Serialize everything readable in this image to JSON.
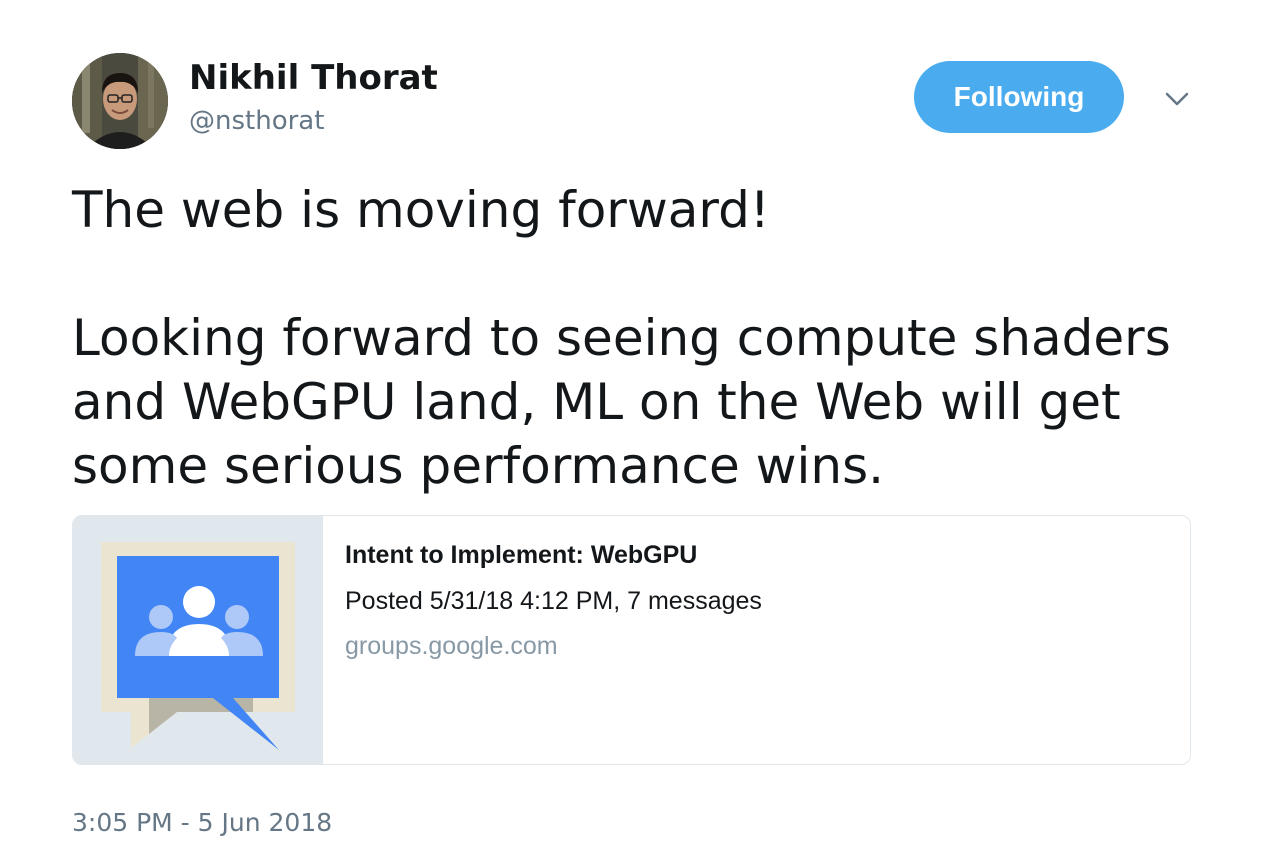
{
  "author": {
    "name": "Nikhil Thorat",
    "handle": "@nsthorat",
    "avatar_icon": "profile-photo"
  },
  "follow_button": {
    "label": "Following",
    "color": "#4aacee"
  },
  "menu": {
    "icon": "chevron-down-icon"
  },
  "tweet": {
    "paragraphs": [
      "The web is moving forward!",
      "Looking forward to seeing compute shaders",
      "and WebGPU land, ML on the Web will get",
      "some serious performance wins."
    ]
  },
  "card": {
    "title": "Intent to Implement: WebGPU",
    "description": "Posted 5/31/18 4:12 PM, 7 messages",
    "domain": "groups.google.com",
    "thumbnail_icon": "google-groups-icon",
    "thumbnail_color": "#4285f4"
  },
  "timestamp": "3:05 PM - 5 Jun 2018"
}
